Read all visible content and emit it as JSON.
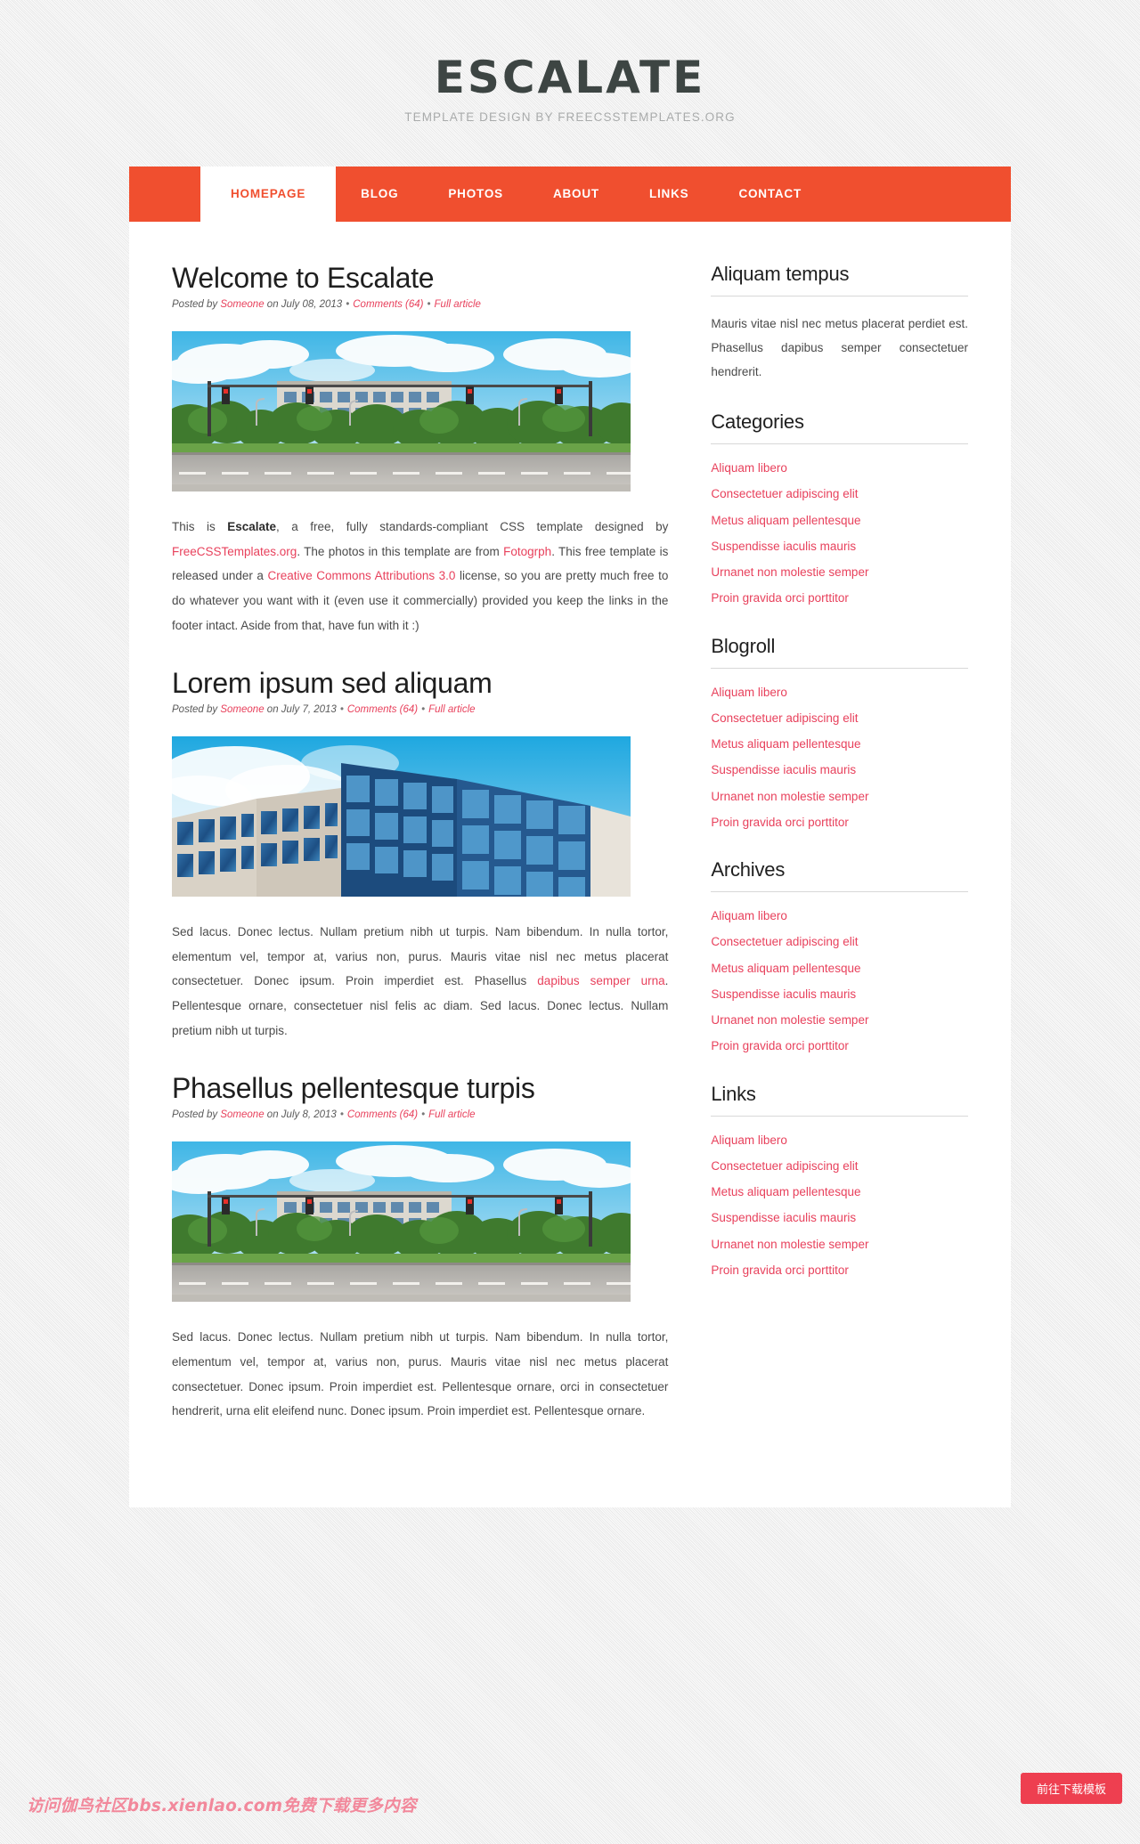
{
  "header": {
    "title": "ESCALATE",
    "tagline": "TEMPLATE DESIGN BY FREECSSTEMPLATES.ORG"
  },
  "nav": {
    "items": [
      {
        "label": "HOMEPAGE",
        "active": true
      },
      {
        "label": "BLOG",
        "active": false
      },
      {
        "label": "PHOTOS",
        "active": false
      },
      {
        "label": "ABOUT",
        "active": false
      },
      {
        "label": "LINKS",
        "active": false
      },
      {
        "label": "CONTACT",
        "active": false
      }
    ]
  },
  "posts": [
    {
      "title": "Welcome to Escalate",
      "meta": {
        "posted_by_label": "Posted by",
        "author": "Someone",
        "on_label": "on",
        "date": "July 08, 2013",
        "comments": "Comments (64)",
        "full_article": "Full article"
      },
      "image": "office-building-street-intersection",
      "body_parts": [
        {
          "type": "text",
          "value": "This is "
        },
        {
          "type": "bold",
          "value": "Escalate"
        },
        {
          "type": "text",
          "value": ", a free, fully standards-compliant CSS template designed by "
        },
        {
          "type": "link",
          "value": "FreeCSSTemplates.org"
        },
        {
          "type": "text",
          "value": ". The photos in this template are from "
        },
        {
          "type": "link",
          "value": "Fotogrph"
        },
        {
          "type": "text",
          "value": ". This free template is released under a "
        },
        {
          "type": "link",
          "value": "Creative Commons Attributions 3.0"
        },
        {
          "type": "text",
          "value": " license, so you are pretty much free to do whatever you want with it (even use it commercially) provided you keep the links in the footer intact. Aside from that, have fun with it :)"
        }
      ]
    },
    {
      "title": "Lorem ipsum sed aliquam",
      "meta": {
        "posted_by_label": "Posted by",
        "author": "Someone",
        "on_label": "on",
        "date": "July 7, 2013",
        "comments": "Comments (64)",
        "full_article": "Full article"
      },
      "image": "glass-office-tower-blue-sky",
      "body_parts": [
        {
          "type": "text",
          "value": "Sed lacus. Donec lectus. Nullam pretium nibh ut turpis. Nam bibendum. In nulla tortor, elementum vel, tempor at, varius non, purus. Mauris vitae nisl nec metus placerat consectetuer. Donec ipsum. Proin imperdiet est. Phasellus "
        },
        {
          "type": "link",
          "value": "dapibus semper urna"
        },
        {
          "type": "text",
          "value": ". Pellentesque ornare, consectetuer nisl felis ac diam. Sed lacus. Donec lectus. Nullam pretium nibh ut turpis."
        }
      ]
    },
    {
      "title": "Phasellus pellentesque turpis",
      "meta": {
        "posted_by_label": "Posted by",
        "author": "Someone",
        "on_label": "on",
        "date": "July 8, 2013",
        "comments": "Comments (64)",
        "full_article": "Full article"
      },
      "image": "office-building-street-intersection",
      "body_parts": [
        {
          "type": "text",
          "value": "Sed lacus. Donec lectus. Nullam pretium nibh ut turpis. Nam bibendum. In nulla tortor, elementum vel, tempor at, varius non, purus. Mauris vitae nisl nec metus placerat consectetuer. Donec ipsum. Proin imperdiet est. Pellentesque ornare, orci in consectetuer hendrerit, urna elit eleifend nunc. Donec ipsum. Proin imperdiet est. Pellentesque ornare."
        }
      ]
    }
  ],
  "sidebar": {
    "blocks": [
      {
        "title": "Aliquam tempus",
        "kind": "text",
        "text": "Mauris vitae nisl nec metus placerat perdiet est. Phasellus dapibus semper consectetuer hendrerit."
      },
      {
        "title": "Categories",
        "kind": "list",
        "items": [
          "Aliquam libero",
          "Consectetuer adipiscing elit",
          "Metus aliquam pellentesque",
          "Suspendisse iaculis mauris",
          "Urnanet non molestie semper",
          "Proin gravida orci porttitor"
        ]
      },
      {
        "title": "Blogroll",
        "kind": "list",
        "items": [
          "Aliquam libero",
          "Consectetuer adipiscing elit",
          "Metus aliquam pellentesque",
          "Suspendisse iaculis mauris",
          "Urnanet non molestie semper",
          "Proin gravida orci porttitor"
        ]
      },
      {
        "title": "Archives",
        "kind": "list",
        "items": [
          "Aliquam libero",
          "Consectetuer adipiscing elit",
          "Metus aliquam pellentesque",
          "Suspendisse iaculis mauris",
          "Urnanet non molestie semper",
          "Proin gravida orci porttitor"
        ]
      },
      {
        "title": "Links",
        "kind": "list",
        "items": [
          "Aliquam libero",
          "Consectetuer adipiscing elit",
          "Metus aliquam pellentesque",
          "Suspendisse iaculis mauris",
          "Urnanet non molestie semper",
          "Proin gravida orci porttitor"
        ]
      }
    ]
  },
  "overlays": {
    "watermark": "访问伽鸟社区bbs.xienlao.com免费下载更多内容",
    "download_button": "前往下载模板"
  },
  "colors": {
    "accent": "#f04f2f",
    "link": "#e8415c",
    "heading": "#1f1f1f",
    "title": "#3d4543",
    "page_bg": "#eeeeee",
    "content_bg": "#ffffff",
    "watermark": "#f2889b",
    "download_button": "#ee3f50"
  }
}
